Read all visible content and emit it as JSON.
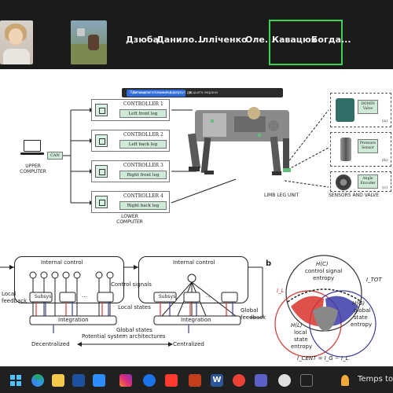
{
  "participants": {
    "names": [
      "Дзюба",
      "Данило...",
      "Ілліченко",
      "Оле...",
      "Кавацюк",
      "Богда..."
    ]
  },
  "share_banner": {
    "message": "Ви надаєте спільний доступ до цього екрана",
    "stop_button": "Припинити спільний доступ"
  },
  "slide": {
    "upper_computer": "UPPER COMPUTER",
    "can_label": "CAN",
    "lower_computer": "LOWER COMPUTER",
    "controllers": [
      {
        "title": "CONTROLLER 1",
        "leg": "Left front leg"
      },
      {
        "title": "CONTROLLER 2",
        "leg": "Left back leg"
      },
      {
        "title": "CONTROLLER 3",
        "leg": "Right front leg"
      },
      {
        "title": "CONTROLLER 4",
        "leg": "Right back leg"
      }
    ],
    "limb_leg_unit": "LIMB LEG UNIT",
    "sensors_and_valve": "SENSORS AND VALVE",
    "sensors": [
      {
        "label": "DOMIN Valve",
        "tag": "(a)"
      },
      {
        "label": "Pressure Sensor",
        "tag": "(b)"
      },
      {
        "label": "Angle Encoder",
        "tag": "(c)"
      }
    ],
    "diagram": {
      "internal_control": "Internal control",
      "control_signals": "Control signals",
      "local_states": "Local states",
      "global_states": "Global states",
      "integration": "Integration",
      "subsys": "Subsys",
      "local_feedback": "Local feedback",
      "global_feedback": "Global feedback",
      "potential": "Potential system architectures",
      "decentralized": "Decentralized",
      "centralized": "Centralized",
      "ellipsis": "..."
    },
    "venn": {
      "panel_letter": "b",
      "hc": "H(C)",
      "hc_sub1": "control signal",
      "hc_sub2": "entropy",
      "hl": "H(L)",
      "hl_sub1": "local",
      "hl_sub2": "state",
      "hl_sub3": "entropy",
      "hg": "H(G)",
      "hg_sub1": "global",
      "hg_sub2": "state",
      "hg_sub3": "entropy",
      "itot": "I_TOT",
      "il": "I_L",
      "icent": "I_CENT = I_G − I_L"
    }
  },
  "taskbar": {
    "weather": "Temps to plu"
  },
  "colors": {
    "speaker_border": "#39d353",
    "controller_fill": "#cfe9d9",
    "venn_red": "#d9342b",
    "venn_blue": "#3a3aa8"
  }
}
